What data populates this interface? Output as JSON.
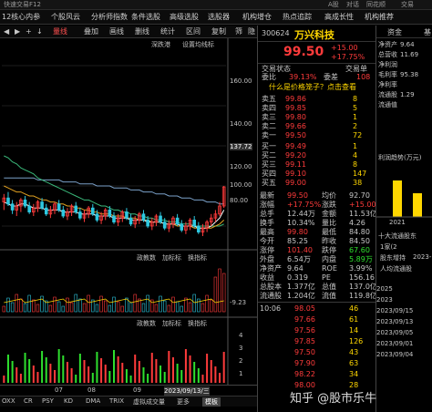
{
  "topbar": {
    "items": [
      "快速交易F12",
      "A股",
      "对话",
      "同花顺",
      "交易"
    ]
  },
  "menubar": {
    "items": [
      "12核心内参",
      "个股风云",
      "分析师指数",
      "条件选股",
      "高级选股",
      "选股器",
      "机构增仓",
      "热点追踪",
      "高成长性",
      "机构推荐"
    ]
  },
  "toolbar": {
    "items": [
      "◀",
      "▶",
      "+",
      "↓",
      "量线",
      "叠加",
      "画线",
      "删线",
      "统计",
      "区间",
      "复制",
      "筛",
      "隐"
    ]
  },
  "chart": {
    "ma_label": "深跌港",
    "ma_label2": "设置均线标",
    "price_levels": [
      "160.00",
      "140.00",
      "120.00",
      "100.00",
      "80.00"
    ],
    "price_marker": "137.72",
    "vol_header": [
      "政教数",
      "加标标",
      "换指标"
    ],
    "vol_levels": [
      "9.23"
    ],
    "vol_right": "-9.23",
    "ind_header": [
      "政教数",
      "加标标",
      "换指标"
    ],
    "ind_levels": [
      "4",
      "3",
      "2",
      "1"
    ],
    "date_label": "2023/09/13/三",
    "date_ticks": [
      "07",
      "08",
      "09"
    ],
    "bottom_tabs": [
      "OXX",
      "CR",
      "PSY",
      "KD",
      "DMA",
      "TRIX",
      "虚拟成交量",
      "更多",
      "模板"
    ]
  },
  "chart_data": {
    "type": "candlestick",
    "note_ylim": [
      70,
      170
    ],
    "ylim": [
      70,
      170
    ],
    "candles": [
      [
        92,
        96,
        88,
        94
      ],
      [
        94,
        97,
        90,
        91
      ],
      [
        91,
        93,
        86,
        88
      ],
      [
        88,
        92,
        85,
        90
      ],
      [
        90,
        94,
        87,
        93
      ],
      [
        93,
        95,
        89,
        90
      ],
      [
        90,
        92,
        86,
        87
      ],
      [
        87,
        91,
        85,
        89
      ],
      [
        89,
        93,
        87,
        92
      ],
      [
        92,
        94,
        88,
        89
      ],
      [
        89,
        91,
        85,
        86
      ],
      [
        86,
        90,
        84,
        88
      ],
      [
        88,
        92,
        86,
        91
      ],
      [
        91,
        93,
        87,
        88
      ],
      [
        88,
        90,
        84,
        85
      ],
      [
        85,
        89,
        83,
        87
      ],
      [
        87,
        91,
        85,
        90
      ],
      [
        90,
        92,
        86,
        87
      ],
      [
        87,
        89,
        83,
        84
      ],
      [
        84,
        88,
        82,
        86
      ],
      [
        86,
        90,
        84,
        89
      ],
      [
        89,
        91,
        85,
        86
      ],
      [
        86,
        88,
        82,
        83
      ],
      [
        83,
        87,
        81,
        85
      ],
      [
        85,
        89,
        83,
        88
      ],
      [
        88,
        90,
        84,
        85
      ],
      [
        85,
        87,
        81,
        82
      ],
      [
        82,
        86,
        80,
        84
      ],
      [
        84,
        88,
        82,
        87
      ],
      [
        87,
        89,
        83,
        84
      ],
      [
        84,
        86,
        80,
        81
      ],
      [
        81,
        85,
        79,
        83
      ],
      [
        83,
        87,
        81,
        86
      ],
      [
        86,
        88,
        82,
        83
      ],
      [
        83,
        85,
        79,
        80
      ],
      [
        80,
        84,
        78,
        82
      ],
      [
        82,
        86,
        80,
        85
      ],
      [
        85,
        87,
        81,
        82
      ],
      [
        82,
        84,
        78,
        79
      ],
      [
        79,
        83,
        77,
        81
      ],
      [
        81,
        85,
        79,
        84
      ],
      [
        84,
        86,
        80,
        81
      ],
      [
        81,
        83,
        77,
        78
      ],
      [
        78,
        82,
        76,
        80
      ],
      [
        80,
        84,
        78,
        83
      ],
      [
        83,
        85,
        79,
        80
      ],
      [
        80,
        82,
        76,
        77
      ],
      [
        77,
        81,
        75,
        79
      ],
      [
        79,
        83,
        77,
        82
      ],
      [
        82,
        86,
        80,
        84
      ],
      [
        84,
        88,
        82,
        86
      ],
      [
        86,
        92,
        85,
        90
      ],
      [
        90,
        100,
        89,
        99.5
      ]
    ],
    "ma5": [
      92,
      91,
      90,
      90,
      91,
      91,
      90,
      89,
      89,
      89,
      88,
      88,
      88,
      88,
      87,
      87,
      87,
      87,
      86,
      86,
      86,
      86,
      85,
      85,
      85,
      85,
      84,
      84,
      84,
      84,
      83,
      83,
      83,
      83,
      82,
      82,
      82,
      82,
      81,
      81,
      81,
      81,
      80,
      80,
      80,
      80,
      79,
      79,
      79,
      80,
      82,
      84,
      88
    ],
    "ma10": [
      100,
      99,
      98,
      97,
      97,
      96,
      95,
      95,
      94,
      93,
      93,
      92,
      92,
      91,
      91,
      90,
      90,
      89,
      89,
      88,
      88,
      87,
      87,
      86,
      86,
      86,
      85,
      85,
      85,
      84,
      84,
      84,
      83,
      83,
      83,
      82,
      82,
      82,
      81,
      81,
      81,
      80,
      80,
      80,
      80,
      79,
      79,
      79,
      79,
      79,
      80,
      81,
      83
    ],
    "ma20": [
      115,
      114,
      112,
      111,
      109,
      108,
      107,
      106,
      104,
      103,
      102,
      101,
      100,
      99,
      98,
      97,
      96,
      95,
      94,
      93,
      93,
      92,
      91,
      90,
      90,
      89,
      88,
      88,
      87,
      87,
      86,
      86,
      85,
      85,
      84,
      84,
      83,
      83,
      83,
      82,
      82,
      82,
      81,
      81,
      81,
      80,
      80,
      80,
      80,
      80,
      80,
      80,
      81
    ],
    "ma60": [
      104,
      104,
      104,
      104,
      104,
      104,
      104,
      104,
      103,
      103,
      103,
      103,
      103,
      103,
      102,
      102,
      102,
      102,
      101,
      101,
      101,
      101,
      100,
      100,
      100,
      100,
      99,
      99,
      99,
      99,
      98,
      98,
      98,
      97,
      97,
      97,
      96,
      96,
      96,
      95,
      95,
      95,
      94,
      94,
      94,
      93,
      93,
      93,
      92,
      92,
      92,
      91,
      91
    ]
  },
  "quote": {
    "code": "300624",
    "name": "万兴科技",
    "price": "99.50",
    "change": "+15.00",
    "change_pct": "+17.75%",
    "tabs": [
      "交易状态",
      "交易单"
    ],
    "weibi_label": "委比",
    "weibi": "39.13%",
    "weicha_label": "委差",
    "weicha": "108",
    "ad_text": "什么是价格笼子？点击查看",
    "asks": [
      {
        "label": "卖五",
        "price": "99.86",
        "vol": "8"
      },
      {
        "label": "卖四",
        "price": "99.85",
        "vol": "5"
      },
      {
        "label": "卖三",
        "price": "99.80",
        "vol": "1"
      },
      {
        "label": "卖二",
        "price": "99.66",
        "vol": "2"
      },
      {
        "label": "卖一",
        "price": "99.50",
        "vol": "72"
      }
    ],
    "bids": [
      {
        "label": "买一",
        "price": "99.49",
        "vol": "1"
      },
      {
        "label": "买二",
        "price": "99.20",
        "vol": "4"
      },
      {
        "label": "买三",
        "price": "99.11",
        "vol": "8"
      },
      {
        "label": "买四",
        "price": "99.10",
        "vol": "147"
      },
      {
        "label": "买五",
        "price": "99.00",
        "vol": "38"
      }
    ],
    "stats": [
      {
        "l1": "最新",
        "v1": "99.50",
        "l2": "均价",
        "v2": "92.70"
      },
      {
        "l1": "涨幅",
        "v1": "+17.75%",
        "l2": "涨跌",
        "v2": "+15.00"
      },
      {
        "l1": "总手",
        "v1": "12.44万",
        "l2": "金额",
        "v2": "11.53亿"
      },
      {
        "l1": "换手",
        "v1": "10.34%",
        "l2": "量比",
        "v2": "4.26"
      },
      {
        "l1": "最高",
        "v1": "99.80",
        "l2": "最低",
        "v2": "84.80"
      },
      {
        "l1": "今开",
        "v1": "85.25",
        "l2": "昨收",
        "v2": "84.50"
      },
      {
        "l1": "涨停",
        "v1": "101.40",
        "l2": "跌停",
        "v2": "67.60"
      },
      {
        "l1": "外盘",
        "v1": "6.54万",
        "l2": "内盘",
        "v2": "5.89万"
      },
      {
        "l1": "净资产",
        "v1": "9.64",
        "l2": "ROE",
        "v2": "3.99%"
      },
      {
        "l1": "收益",
        "v1": "0.319",
        "l2": "PE",
        "v2": "156.16"
      },
      {
        "l1": "总股本",
        "v1": "1.377亿",
        "l2": "总值",
        "v2": "137.0亿"
      },
      {
        "l1": "流通股",
        "v1": "1.204亿",
        "l2": "流值",
        "v2": "119.8亿"
      }
    ],
    "ticks": [
      {
        "time": "10:06",
        "price": "98.05",
        "vol": "46"
      },
      {
        "time": "",
        "price": "97.66",
        "vol": "61"
      },
      {
        "time": "",
        "price": "97.56",
        "vol": "14"
      },
      {
        "time": "",
        "price": "97.85",
        "vol": "126"
      },
      {
        "time": "",
        "price": "97.50",
        "vol": "43"
      },
      {
        "time": "",
        "price": "97.90",
        "vol": "63"
      },
      {
        "time": "",
        "price": "98.22",
        "vol": "34"
      },
      {
        "time": "",
        "price": "98.00",
        "vol": "28"
      }
    ]
  },
  "rside": {
    "tabs": [
      "资金",
      "基"
    ],
    "rows": [
      "净资产",
      "总营收",
      "净利润",
      "毛利率",
      "净利率",
      "流通股",
      "流通值"
    ],
    "values": [
      "9.64",
      "11.69",
      "",
      "95.38",
      "",
      "1.29",
      ""
    ],
    "profit_title": "利润趋势(万元)",
    "profit_year": "2021",
    "holders_title": "十大流通股东",
    "holders_label1": "1家(2",
    "holders_label2": "股东增持",
    "holders_label3": "2023-",
    "holders_label4": "人均流通股",
    "year_rows": [
      "2025",
      "2023",
      "2023/09/15",
      "2023/09/13",
      "2023/09/05",
      "2023/09/01",
      "2023/09/04"
    ],
    "year_vals": [
      "",
      "",
      "",
      "",
      "",
      "",
      ""
    ]
  },
  "watermark": "知乎 @股市乐牛"
}
